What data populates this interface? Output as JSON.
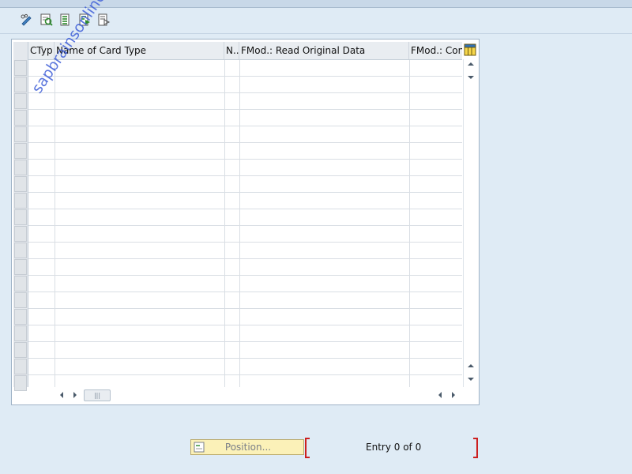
{
  "toolbar": {
    "buttons": [
      {
        "name": "edit-icon"
      },
      {
        "name": "details-icon"
      },
      {
        "name": "select-all-icon"
      },
      {
        "name": "select-block-icon"
      },
      {
        "name": "deselect-all-icon"
      }
    ]
  },
  "table": {
    "columns": [
      "CTyp",
      "Name of Card Type",
      "N..",
      "FMod.: Read Original Data",
      "FMod.: Conv"
    ],
    "visible_rows": 20,
    "rows": []
  },
  "watermark": "sapbrainsonline.com",
  "footer": {
    "position_label": "Position...",
    "entry_text": "Entry 0 of 0"
  }
}
